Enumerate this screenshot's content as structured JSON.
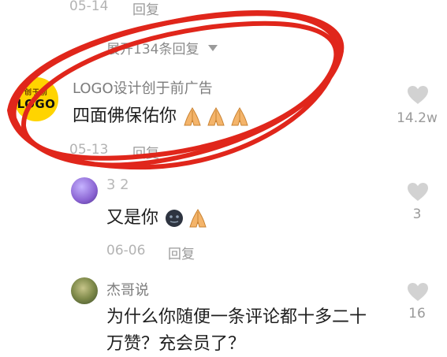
{
  "top": {
    "date": "05-14",
    "reply": "回复"
  },
  "expand": {
    "label": "展开134条回复"
  },
  "comment1": {
    "author": "LOGO设计创于前广告",
    "text": "四面佛保佑你",
    "avatar_top": "创于前",
    "avatar_bottom": "LOGO",
    "date": "05-13",
    "reply": "回复",
    "likes": "14.2w"
  },
  "comment2": {
    "author": "3  2",
    "text": "又是你",
    "date": "06-06",
    "reply": "回复",
    "likes": "3"
  },
  "comment3": {
    "author": "杰哥说",
    "text_line1": "为什么你随便一条评论都十多二十",
    "text_line2": "万赞？充会员了？",
    "likes": "16"
  },
  "icons": {
    "heart": "heart-icon",
    "pray": "folded-hands-icon",
    "face": "dark-face-icon",
    "caret": "caret-down-icon"
  },
  "colors": {
    "scribble": "#e0261b",
    "heart": "#d2d2d2",
    "logo_yellow": "#ffd400"
  }
}
